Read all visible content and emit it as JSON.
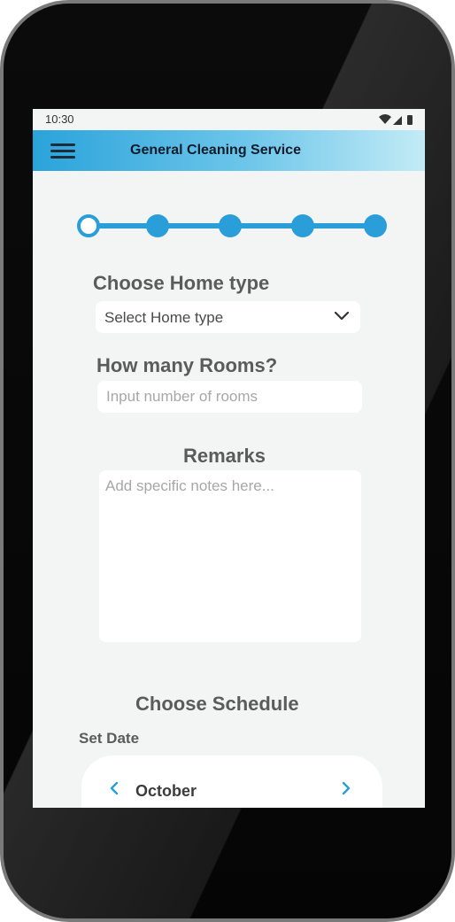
{
  "status_bar": {
    "time": "10:30"
  },
  "app_bar": {
    "title": "General Cleaning Service",
    "menu_icon": "menu-icon"
  },
  "stepper": {
    "total_steps": 5,
    "current_step": 1
  },
  "home_type": {
    "heading": "Choose Home type",
    "select_value": "Select Home type"
  },
  "rooms": {
    "heading": "How many Rooms?",
    "placeholder": "Input number of rooms"
  },
  "remarks": {
    "heading": "Remarks",
    "placeholder": "Add specific notes here..."
  },
  "schedule": {
    "heading": "Choose Schedule",
    "set_date_label": "Set Date",
    "calendar": {
      "month": "October"
    }
  },
  "colors": {
    "accent": "#2a9ed8",
    "background": "#f3f5f5",
    "label": "#5b5b5b"
  }
}
